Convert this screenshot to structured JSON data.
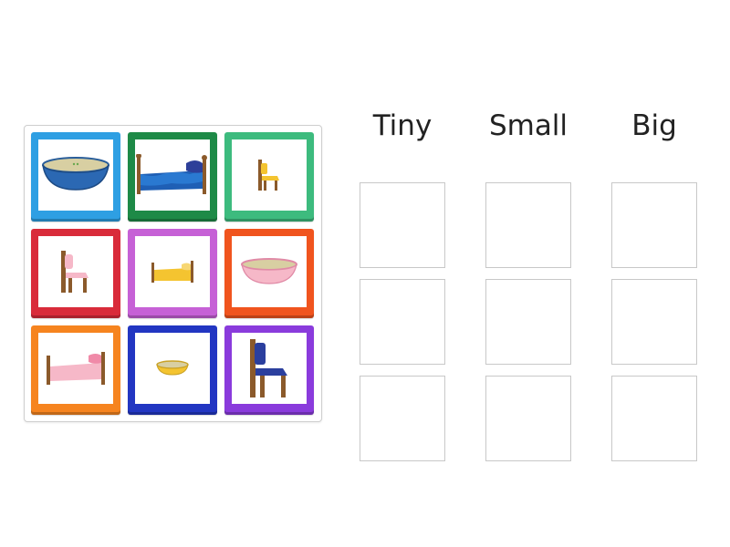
{
  "activity": {
    "type": "group-sort",
    "cards": [
      {
        "item": "bowl",
        "size": "big",
        "frame_color": "#2e9fe3",
        "icon": "bowl-icon"
      },
      {
        "item": "bed",
        "size": "small",
        "frame_color": "#1e8a47",
        "icon": "bed-icon"
      },
      {
        "item": "chair",
        "size": "tiny",
        "frame_color": "#3dbb7e",
        "icon": "chair-icon"
      },
      {
        "item": "chair",
        "size": "small",
        "frame_color": "#d92b3a",
        "icon": "chair-icon"
      },
      {
        "item": "bed",
        "size": "tiny",
        "frame_color": "#c661d6",
        "icon": "bed-icon"
      },
      {
        "item": "bowl",
        "size": "small",
        "frame_color": "#f0541e",
        "icon": "bowl-icon"
      },
      {
        "item": "bed",
        "size": "big",
        "frame_color": "#f6841f",
        "icon": "bed-icon"
      },
      {
        "item": "bowl",
        "size": "tiny",
        "frame_color": "#2236c2",
        "icon": "bowl-icon"
      },
      {
        "item": "chair",
        "size": "big",
        "frame_color": "#8a3bdc",
        "icon": "chair-icon"
      }
    ],
    "columns": [
      {
        "label": "Tiny",
        "slots": 3
      },
      {
        "label": "Small",
        "slots": 3
      },
      {
        "label": "Big",
        "slots": 3
      }
    ]
  }
}
